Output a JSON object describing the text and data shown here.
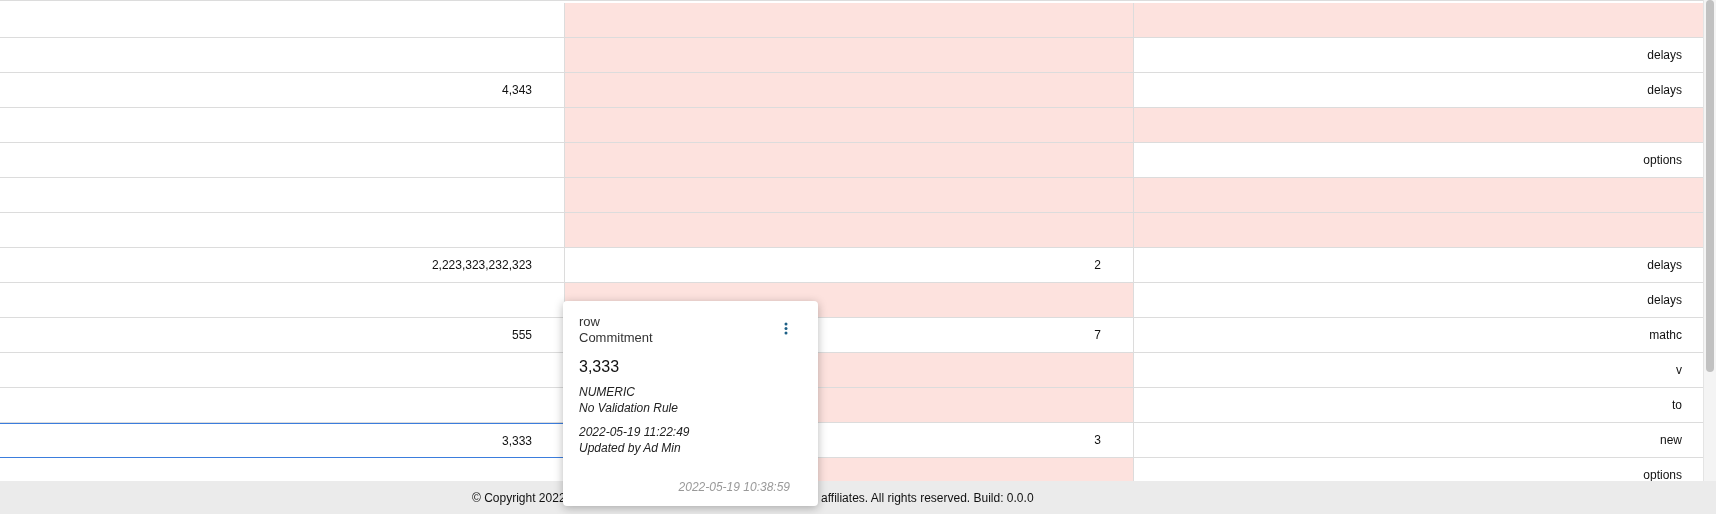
{
  "grid": {
    "rows": [
      {
        "selected": false,
        "cells": [
          {
            "text": "",
            "flagged": false
          },
          {
            "text": "",
            "flagged": true
          },
          {
            "text": "",
            "flagged": true
          }
        ]
      },
      {
        "selected": false,
        "cells": [
          {
            "text": "",
            "flagged": false
          },
          {
            "text": "",
            "flagged": true
          },
          {
            "text": "delays",
            "flagged": false
          }
        ]
      },
      {
        "selected": false,
        "cells": [
          {
            "text": "4,343",
            "flagged": false
          },
          {
            "text": "",
            "flagged": true
          },
          {
            "text": "delays",
            "flagged": false
          }
        ]
      },
      {
        "selected": false,
        "cells": [
          {
            "text": "",
            "flagged": false
          },
          {
            "text": "",
            "flagged": true
          },
          {
            "text": "",
            "flagged": true
          }
        ]
      },
      {
        "selected": false,
        "cells": [
          {
            "text": "",
            "flagged": false
          },
          {
            "text": "",
            "flagged": true
          },
          {
            "text": "options",
            "flagged": false
          }
        ]
      },
      {
        "selected": false,
        "cells": [
          {
            "text": "",
            "flagged": false
          },
          {
            "text": "",
            "flagged": true
          },
          {
            "text": "",
            "flagged": true
          }
        ]
      },
      {
        "selected": false,
        "cells": [
          {
            "text": "",
            "flagged": false
          },
          {
            "text": "",
            "flagged": true
          },
          {
            "text": "",
            "flagged": true
          }
        ]
      },
      {
        "selected": false,
        "cells": [
          {
            "text": "2,223,323,232,323",
            "flagged": false
          },
          {
            "text": "2",
            "flagged": false
          },
          {
            "text": "delays",
            "flagged": false
          }
        ]
      },
      {
        "selected": false,
        "cells": [
          {
            "text": "",
            "flagged": false
          },
          {
            "text": "",
            "flagged": true
          },
          {
            "text": "delays",
            "flagged": false
          }
        ]
      },
      {
        "selected": false,
        "cells": [
          {
            "text": "555",
            "flagged": false
          },
          {
            "text": "7",
            "flagged": false
          },
          {
            "text": "mathc",
            "flagged": false
          }
        ]
      },
      {
        "selected": false,
        "cells": [
          {
            "text": "",
            "flagged": false
          },
          {
            "text": "",
            "flagged": true
          },
          {
            "text": "v",
            "flagged": false
          }
        ]
      },
      {
        "selected": false,
        "cells": [
          {
            "text": "",
            "flagged": false
          },
          {
            "text": "",
            "flagged": true
          },
          {
            "text": "to",
            "flagged": false
          }
        ]
      },
      {
        "selected": true,
        "cells": [
          {
            "text": "3,333",
            "flagged": false
          },
          {
            "text": "3",
            "flagged": false
          },
          {
            "text": "new",
            "flagged": false
          }
        ]
      },
      {
        "selected": false,
        "cells": [
          {
            "text": "",
            "flagged": false
          },
          {
            "text": "",
            "flagged": true
          },
          {
            "text": "options",
            "flagged": false
          }
        ]
      }
    ]
  },
  "cell_popup": {
    "label": "row",
    "column": "Commitment",
    "value": "3,333",
    "type": "NUMERIC",
    "validation": "No Validation Rule",
    "updated_at": "2022-05-19 11:22:49",
    "updated_by": "Updated by Ad Min",
    "created_at": "2022-05-19 10:38:59"
  },
  "footer": {
    "texts": [
      "© Copyright 2022",
      "affiliates. All rights reserved. Build: 0.0.0"
    ]
  }
}
